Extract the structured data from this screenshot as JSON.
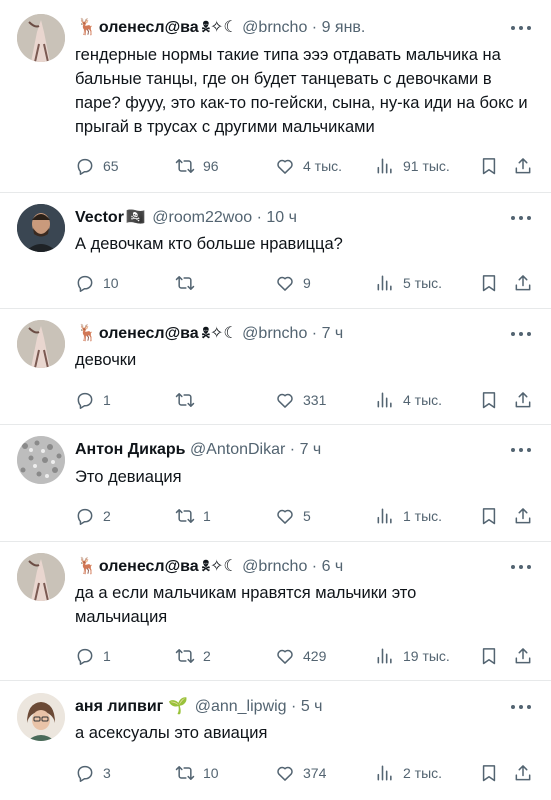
{
  "colors": {
    "text": "#0f1419",
    "secondary": "#536471",
    "divider": "#e7e9ea",
    "background": "#ffffff"
  },
  "icons": {
    "reply": "speech-bubble",
    "retweet": "retweet-arrows",
    "like": "heart",
    "views": "bar-chart",
    "bookmark": "bookmark",
    "share": "share-arrow",
    "more": "three-dots"
  },
  "tweets": [
    {
      "name": "оленесл@ва",
      "name_emoji": "🦌",
      "name_deco": "🕱✧☾",
      "handle": "@brncho",
      "dot": "·",
      "time": "9 янв.",
      "text": "гендерные нормы такие типа эээ отдавать мальчика на бальные танцы, где он будет танцевать с девочками в паре? фууу, это как-то по-гейски, сына, ну-ка иди на бокс и прыгай в трусах с другими мальчиками",
      "replies": "65",
      "retweets": "96",
      "likes": "4 тыс.",
      "views": "91 тыс."
    },
    {
      "name": "Vector",
      "name_emoji": "🏴‍☠️",
      "name_deco": "",
      "handle": "@room22woo",
      "dot": "·",
      "time": "10 ч",
      "text": "А девочкам кто больше нравицца?",
      "replies": "10",
      "retweets": "",
      "likes": "9",
      "views": "5 тыс."
    },
    {
      "name": "оленесл@ва",
      "name_emoji": "🦌",
      "name_deco": "🕱✧☾",
      "handle": "@brncho",
      "dot": "·",
      "time": "7 ч",
      "text": "девочки",
      "replies": "1",
      "retweets": "",
      "likes": "331",
      "views": "4 тыс."
    },
    {
      "name": "Антон Дикарь",
      "name_emoji": "",
      "name_deco": "",
      "handle": "@AntonDikar",
      "dot": "·",
      "time": "7 ч",
      "text": "Это девиация",
      "replies": "2",
      "retweets": "1",
      "likes": "5",
      "views": "1 тыс."
    },
    {
      "name": "оленесл@ва",
      "name_emoji": "🦌",
      "name_deco": "🕱✧☾",
      "handle": "@brncho",
      "dot": "·",
      "time": "6 ч",
      "text": "да а если мальчикам нравятся мальчики это мальчиация",
      "replies": "1",
      "retweets": "2",
      "likes": "429",
      "views": "19 тыс."
    },
    {
      "name": "аня липвиг",
      "name_emoji": "🌱",
      "name_deco": "",
      "handle": "@ann_lipwig",
      "dot": "·",
      "time": "5 ч",
      "text": "а асексуалы это авиация",
      "replies": "3",
      "retweets": "10",
      "likes": "374",
      "views": "2 тыс."
    }
  ]
}
